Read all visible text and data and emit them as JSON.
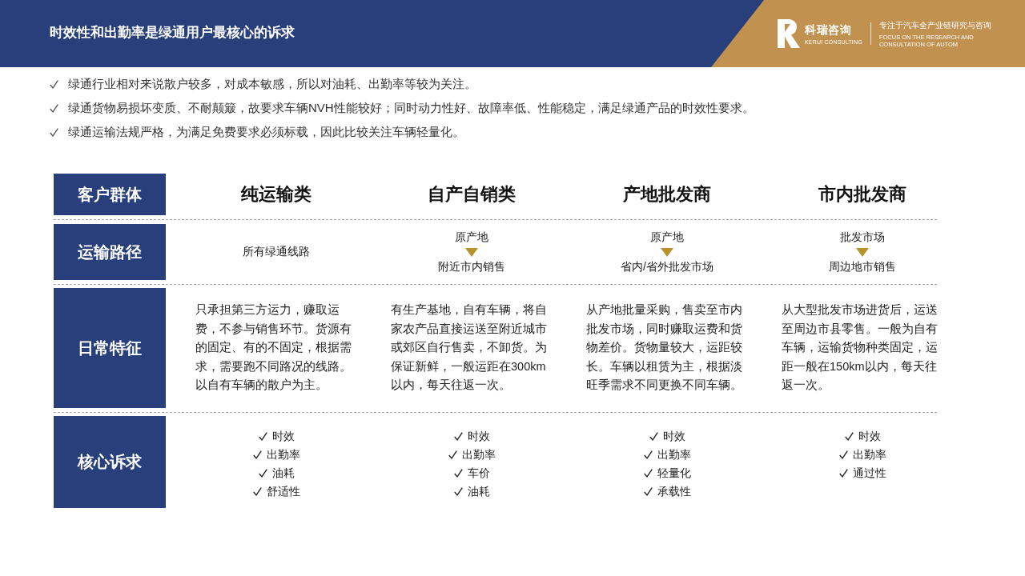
{
  "header": {
    "title": "时效性和出勤率是绿通用户最核心的诉求",
    "brand": {
      "name": "科瑞咨询",
      "name_en": "KERUI CONSULTING",
      "tagline": "专注于汽车全产业链研究与咨询",
      "tagline_en": "FOCUS ON THE RESEARCH AND CONSULTATION OF AUTOM"
    }
  },
  "bullets": [
    "绿通行业相对来说散户较多，对成本敏感，所以对油耗、出勤率等较为关注。",
    "绿通货物易损坏变质、不耐颠簸，故要求车辆NVH性能较好；同时动力性好、故障率低、性能稳定，满足绿通产品的时效性要求。",
    "绿通运输法规严格，为满足免费要求必须标载，因此比较关注车辆轻量化。"
  ],
  "table": {
    "corner_label": "客户群体",
    "columns": [
      "纯运输类",
      "自产自销类",
      "产地批发商",
      "市内批发商"
    ],
    "rows": [
      {
        "label": "运输路径",
        "kind": "route",
        "cells": [
          {
            "kind": "plain",
            "text": "所有绿通线路"
          },
          {
            "kind": "flow",
            "from": "原产地",
            "to": "附近市内销售"
          },
          {
            "kind": "flow",
            "from": "原产地",
            "to": "省内/省外批发市场"
          },
          {
            "kind": "flow",
            "from": "批发市场",
            "to": "周边地市销售"
          }
        ]
      },
      {
        "label": "日常特征",
        "kind": "text",
        "cells": [
          "只承担第三方运力，赚取运费，不参与销售环节。货源有的固定、有的不固定，根据需求，需要跑不同路况的线路。以自有车辆的散户为主。",
          "有生产基地，自有车辆，将自家农产品直接运送至附近城市或郊区自行售卖，不卸货。为保证新鲜，一般运距在300km以内，每天往返一次。",
          "从产地批量采购，售卖至市内批发市场，同时赚取运费和货物差价。货物量较大，运距较长。车辆以租赁为主，根据淡旺季需求不同更换不同车辆。",
          "从大型批发市场进货后，运送至周边市县零售。一般为自有车辆，运输货物种类固定，运距一般在150km以内，每天往返一次。"
        ]
      },
      {
        "label": "核心诉求",
        "kind": "checklist",
        "cells": [
          [
            "时效",
            "出勤率",
            "油耗",
            "舒适性"
          ],
          [
            "时效",
            "出勤率",
            "车价",
            "油耗"
          ],
          [
            "时效",
            "出勤率",
            "轻量化",
            "承载性"
          ],
          [
            "时效",
            "出勤率",
            "通过性"
          ]
        ]
      }
    ]
  }
}
